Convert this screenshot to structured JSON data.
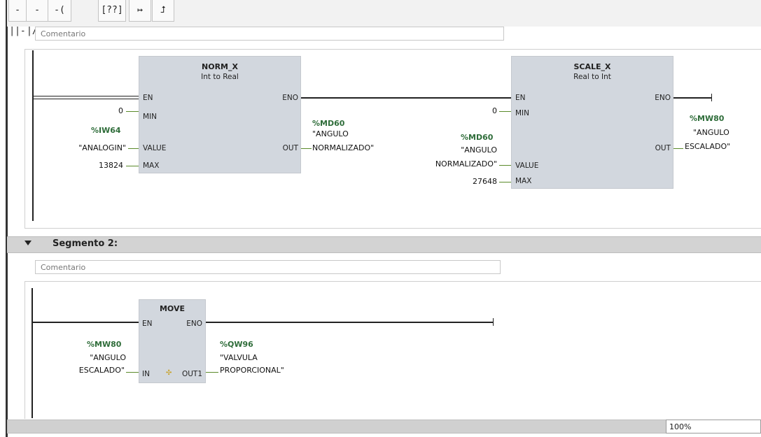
{
  "toolbar": {
    "buttons": [
      {
        "name": "contact-no-button",
        "label": "-||-"
      },
      {
        "name": "contact-nc-button",
        "label": "-|/|-"
      },
      {
        "name": "coil-button",
        "label": "-( )-"
      },
      {
        "name": "empty-box-button",
        "label": "[??]"
      },
      {
        "name": "open-branch-button",
        "label": "↦"
      },
      {
        "name": "close-branch-button",
        "label": "⮥"
      }
    ]
  },
  "segment1": {
    "comment": "Comentario",
    "norm_x": {
      "title": "NORM_X",
      "subtitle": "Int to Real",
      "pins": {
        "en": "EN",
        "eno": "ENO",
        "min": "MIN",
        "value": "VALUE",
        "max": "MAX",
        "out": "OUT"
      },
      "min_value": "0",
      "value_addr": "%IW64",
      "value_tag": "\"ANALOGIN\"",
      "max_value": "13824",
      "out_addr": "%MD60",
      "out_tag_line1": "\"ANGULO",
      "out_tag_line2": "NORMALIZADO\""
    },
    "scale_x": {
      "title": "SCALE_X",
      "subtitle": "Real to Int",
      "pins": {
        "en": "EN",
        "eno": "ENO",
        "min": "MIN",
        "value": "VALUE",
        "max": "MAX",
        "out": "OUT"
      },
      "min_value": "0",
      "value_addr": "%MD60",
      "value_tag_line1": "\"ANGULO",
      "value_tag_line2": "NORMALIZADO\"",
      "max_value": "27648",
      "out_addr": "%MW80",
      "out_tag_line1": "\"ANGULO",
      "out_tag_line2": "ESCALADO\""
    }
  },
  "segment2": {
    "title": "Segmento 2:",
    "comment": "Comentario",
    "move": {
      "title": "MOVE",
      "pins": {
        "en": "EN",
        "eno": "ENO",
        "in": "IN",
        "out1": "OUT1"
      },
      "in_addr": "%MW80",
      "in_tag_line1": "\"ANGULO",
      "in_tag_line2": "ESCALADO\"",
      "out_addr": "%QW96",
      "out_tag_line1": "\"VALVULA",
      "out_tag_line2": "PROPORCIONAL\""
    }
  },
  "zoom": "100%"
}
